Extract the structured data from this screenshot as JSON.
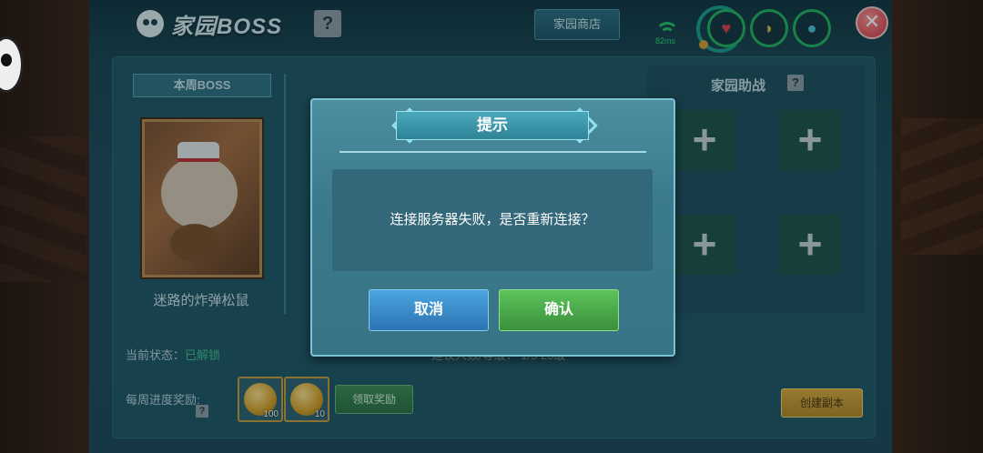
{
  "header": {
    "title": "家园BOSS",
    "help_glyph": "?",
    "shop_label": "家园商店",
    "ping": "82ms",
    "close_glyph": "✕"
  },
  "boss": {
    "week_banner": "本周BOSS",
    "name": "迷路的炸弹松鼠"
  },
  "assist": {
    "title": "家园助战",
    "help_glyph": "?",
    "slot_glyph": "+"
  },
  "status": {
    "label": "当前状态：",
    "value": "已解锁",
    "partial": "建议人数/等级：  1/5  25级"
  },
  "rewards": {
    "label": "每周进度奖励:",
    "help_glyph": "?",
    "items": [
      {
        "qty": "100"
      },
      {
        "qty": "10"
      }
    ],
    "claim_label": "领取奖励",
    "create_label": "创建副本"
  },
  "dialog": {
    "title": "提示",
    "message": "连接服务器失败，是否重新连接？",
    "cancel_label": "取消",
    "confirm_label": "确认"
  },
  "colors": {
    "cancel": "#2c73b4",
    "confirm": "#3a8f3c",
    "claim": "#2a6b3b",
    "create": "#b48322"
  }
}
